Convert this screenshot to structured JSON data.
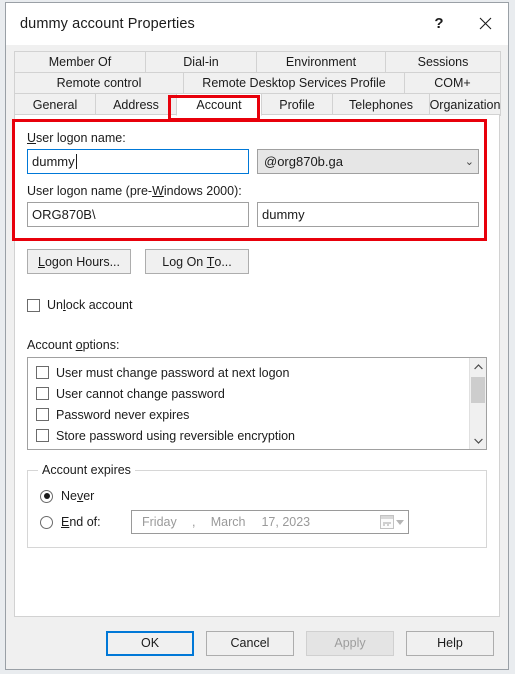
{
  "window": {
    "title": "dummy account Properties",
    "help_button": "?",
    "close_button": "✕"
  },
  "tabs": {
    "row1": [
      {
        "label": "Member Of",
        "selected": false
      },
      {
        "label": "Dial-in",
        "selected": false
      },
      {
        "label": "Environment",
        "selected": false
      },
      {
        "label": "Sessions",
        "selected": false
      }
    ],
    "row2": [
      {
        "label": "Remote control",
        "selected": false
      },
      {
        "label": "Remote Desktop Services Profile",
        "selected": false
      },
      {
        "label": "COM+",
        "selected": false
      }
    ],
    "row3": [
      {
        "label": "General",
        "selected": false
      },
      {
        "label": "Address",
        "selected": false
      },
      {
        "label": "Account",
        "selected": true
      },
      {
        "label": "Profile",
        "selected": false
      },
      {
        "label": "Telephones",
        "selected": false
      },
      {
        "label": "Organization",
        "selected": false
      }
    ]
  },
  "account": {
    "logon_name_label": "User logon name:",
    "logon_name_value": "dummy",
    "domain_suffix": "@org870b.ga",
    "domain_suffix_arrow": "⌄",
    "pre2000_label": "User logon name (pre-Windows 2000):",
    "pre2000_domain": "ORG870B\\",
    "pre2000_user": "dummy",
    "logon_hours_button": "Logon Hours...",
    "log_on_to_button": "Log On To...",
    "unlock_account_label": "Unlock account",
    "unlock_account_checked": false,
    "options_label": "Account options:",
    "options": [
      {
        "label": "User must change password at next logon",
        "checked": false
      },
      {
        "label": "User cannot change password",
        "checked": false
      },
      {
        "label": "Password never expires",
        "checked": false
      },
      {
        "label": "Store password using reversible encryption",
        "checked": false
      }
    ],
    "scroll_up_arrow": "⌃",
    "scroll_down_arrow": "⌄",
    "expires": {
      "group_title": "Account expires",
      "never_label": "Never",
      "never_selected": true,
      "end_of_label": "End of:",
      "end_of_selected": false,
      "date_weekday": "Friday",
      "date_comma": ",",
      "date_month": "March",
      "date_day_year": "17, 2023"
    }
  },
  "footer": {
    "ok": "OK",
    "cancel": "Cancel",
    "apply": "Apply",
    "help": "Help",
    "apply_disabled": true
  },
  "colors": {
    "accent": "#0078d7",
    "annotation": "#e8000b",
    "window_bg": "#f0f0f0",
    "panel_bg": "#ffffff"
  }
}
